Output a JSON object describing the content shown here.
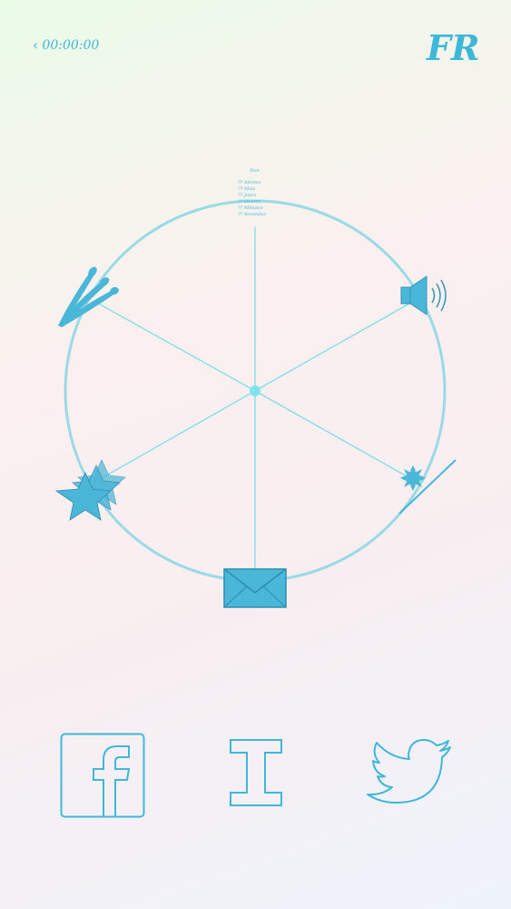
{
  "header": {
    "back_icon": "chevron-left-icon",
    "timer": "00:00:00",
    "language": "FR"
  },
  "menu": {
    "heading": "Non",
    "items": [
      "?? Années",
      "?? Mois",
      "?? Jours",
      "?? Heures",
      "?? Minutes",
      "?? Secondes"
    ]
  },
  "wheel": {
    "icons": [
      "volume-icon",
      "day-night-icon",
      "envelope-icon",
      "stars-icon",
      "comet-icon"
    ],
    "accent": "#3fb7d9",
    "ring": "#9ad9e6",
    "fill": "#4ab6d8"
  },
  "social": {
    "items": [
      "facebook-icon",
      "instapaper-icon",
      "twitter-icon"
    ]
  }
}
